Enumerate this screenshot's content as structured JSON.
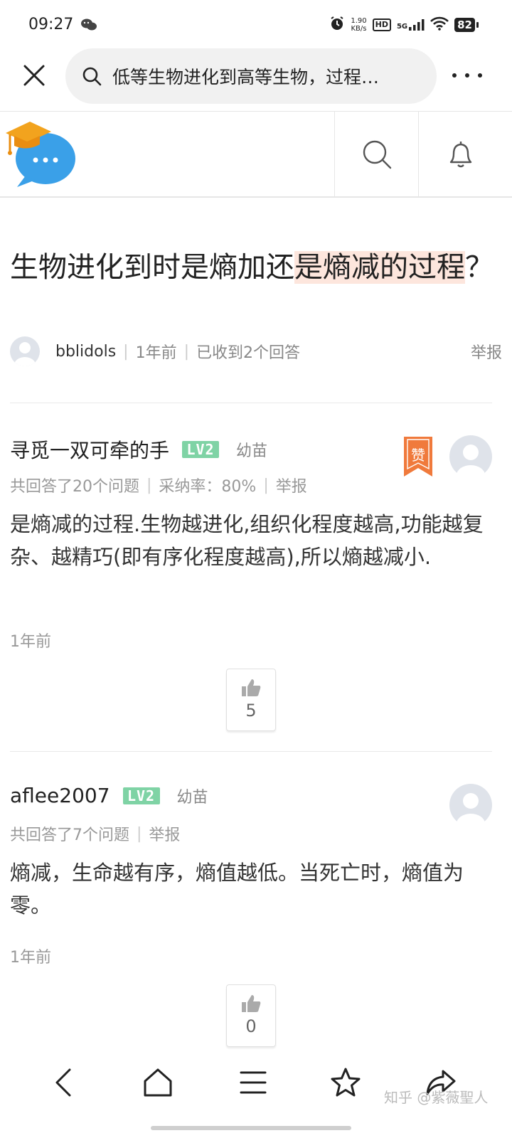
{
  "status": {
    "time": "09:27",
    "speed_value": "1.90",
    "speed_unit": "KB/s",
    "hd": "HD",
    "network": "5G",
    "battery": "82"
  },
  "browser": {
    "search_text": "低等生物进化到高等生物，过程…"
  },
  "question": {
    "title_plain": "生物进化到时是熵加还",
    "title_highlight": "是熵减的过程",
    "title_end": "？",
    "author": "bblidols",
    "time": "1年前",
    "answers_count": "已收到2个回答",
    "report": "举报"
  },
  "answers": [
    {
      "name": "寻觅一双可牵的手",
      "level": "LV2",
      "level_name": "幼苗",
      "stats_count": "共回答了20个问题",
      "stats_rate": "采纳率：80%",
      "report": "举报",
      "body": "是熵减的过程.生物越进化,组织化程度越高,功能越复杂、越精巧(即有序化程度越高),所以熵越减小.",
      "time": "1年前",
      "likes": "5",
      "badge": "赞"
    },
    {
      "name": "aflee2007",
      "level": "LV2",
      "level_name": "幼苗",
      "stats_count": "共回答了7个问题",
      "report": "举报",
      "body": "熵减，生命越有序，熵值越低。当死亡时，熵值为零。",
      "time": "1年前",
      "likes": "0"
    }
  ],
  "watermark": "知乎 @紫薇聖人",
  "icons": {
    "close": "close-icon",
    "search": "search-icon",
    "more": "more-icon",
    "bell": "bell-icon",
    "thumb": "thumb-up-icon",
    "back": "back-icon",
    "home": "home-icon",
    "menu": "menu-icon",
    "star": "star-icon",
    "share": "share-icon"
  },
  "colors": {
    "highlight": "#fde6dd",
    "level_badge": "#7fd3a5",
    "zan_ribbon": "#f07a3c"
  }
}
